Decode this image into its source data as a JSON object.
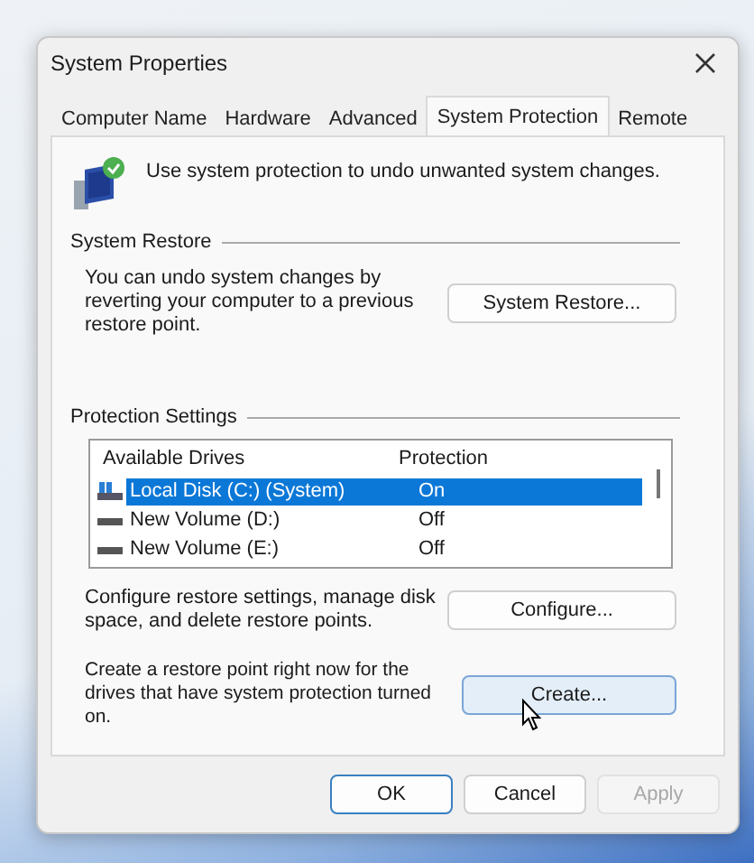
{
  "window": {
    "title": "System Properties"
  },
  "tabs": [
    {
      "label": "Computer Name",
      "selected": false
    },
    {
      "label": "Hardware",
      "selected": false
    },
    {
      "label": "Advanced",
      "selected": false
    },
    {
      "label": "System Protection",
      "selected": true
    },
    {
      "label": "Remote",
      "selected": false
    }
  ],
  "intro": "Use system protection to undo unwanted system changes.",
  "system_restore": {
    "heading": "System Restore",
    "text": "You can undo system changes by reverting your computer to a previous restore point.",
    "button": "System Restore..."
  },
  "protection_settings": {
    "heading": "Protection Settings",
    "columns": [
      "Available Drives",
      "Protection"
    ],
    "drives": [
      {
        "name": "Local Disk (C:) (System)",
        "protection": "On",
        "kind": "system",
        "selected": true
      },
      {
        "name": "New Volume (D:)",
        "protection": "Off",
        "kind": "volume",
        "selected": false
      },
      {
        "name": "New Volume (E:)",
        "protection": "Off",
        "kind": "volume",
        "selected": false
      }
    ],
    "configure_text": "Configure restore settings, manage disk space, and delete restore points.",
    "configure_button": "Configure...",
    "create_text": "Create a restore point right now for the drives that have system protection turned on.",
    "create_button": "Create..."
  },
  "buttons": [
    {
      "label": "OK",
      "default": true,
      "disabled": false
    },
    {
      "label": "Cancel",
      "default": false,
      "disabled": false
    },
    {
      "label": "Apply",
      "default": false,
      "disabled": true
    }
  ]
}
